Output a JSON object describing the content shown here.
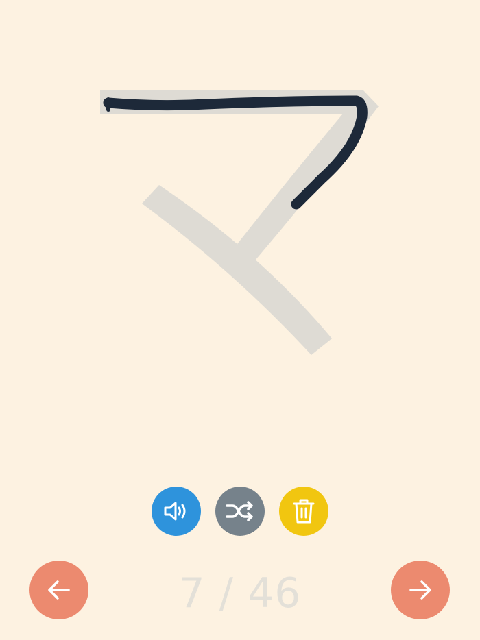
{
  "character": {
    "glyph": "マ"
  },
  "toolbar": {
    "sound": {
      "icon": "speaker-icon",
      "color": "#2e93dc"
    },
    "shuffle": {
      "icon": "shuffle-icon",
      "color": "#76828b"
    },
    "clear": {
      "icon": "trash-icon",
      "color": "#f1c610"
    }
  },
  "navigation": {
    "prev_icon": "arrow-left-icon",
    "next_icon": "arrow-right-icon",
    "color": "#ec8a6f"
  },
  "progress": {
    "current": 7,
    "total": 46,
    "label": "7 / 46"
  },
  "colors": {
    "background": "#fdf2e1",
    "guide_stroke": "#dedbd4",
    "ink": "#1d2939",
    "counter_text": "#e3e0d8"
  }
}
